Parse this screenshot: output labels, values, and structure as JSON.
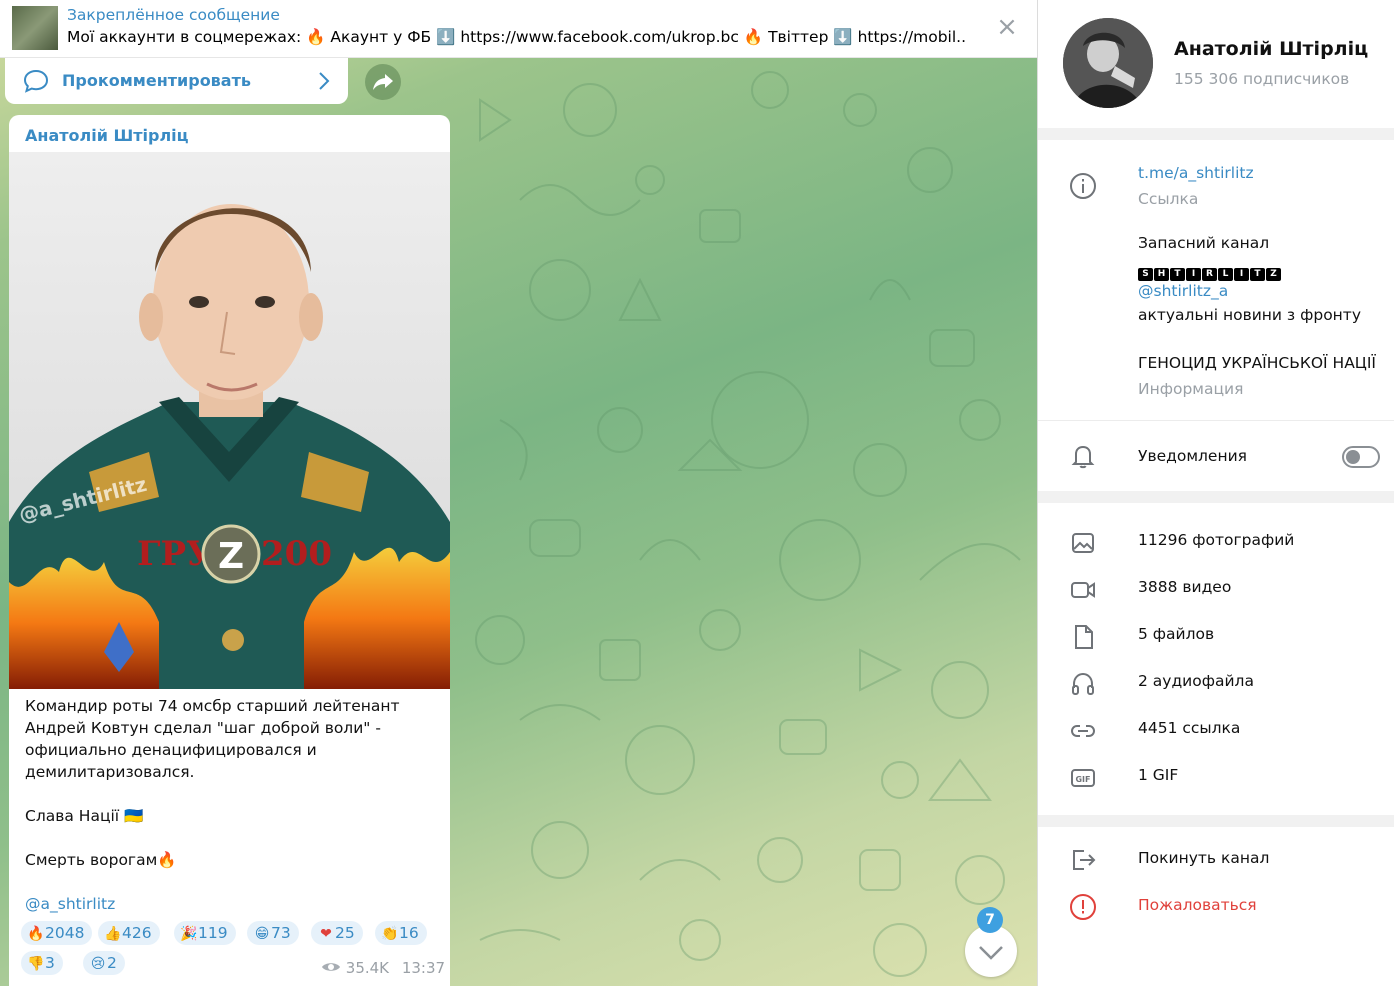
{
  "pinned": {
    "title": "Закреплённое сообщение",
    "text": "Мої аккаунти в соцмережах: 🔥 Акаунт у ФБ ⬇️ https://www.facebook.com/ukrop.bc  🔥 Твіттер ⬇️ https://mobil..."
  },
  "comments": {
    "label": "Прокомментировать"
  },
  "message": {
    "author": "Анатолій Штірліц",
    "photo": {
      "watermark": "@a_shtirlitz",
      "badge_left": "ГРУ",
      "badge_letter": "Z",
      "badge_right": "200"
    },
    "lines": [
      "Командир роты 74 омсбр старший лейтенант",
      "Андрей Ковтун сделал \"шаг доброй воли\" -",
      "официально денацифицировался и",
      "демилитаризовался."
    ],
    "slava": "Слава Нації 🇺🇦",
    "smert": "Смерть ворогам🔥",
    "signature": "@a_shtirlitz",
    "reactions": [
      {
        "emoji": "🔥",
        "count": "2048"
      },
      {
        "emoji": "👍",
        "count": "426"
      },
      {
        "emoji": "🎉",
        "count": "119"
      },
      {
        "emoji": "😁",
        "count": "73"
      },
      {
        "emoji": "❤",
        "count": "25"
      },
      {
        "emoji": "👏",
        "count": "16"
      },
      {
        "emoji": "👎",
        "count": "3"
      },
      {
        "emoji": "😢",
        "count": "2"
      }
    ],
    "views": "35.4K",
    "time": "13:37"
  },
  "scroll": {
    "unread": "7"
  },
  "channel": {
    "name": "Анатолій Штірліц",
    "subscribers": "155 306 подписчиков",
    "link": "t.me/a_shtirlitz",
    "link_caption": "Ссылка",
    "desc_line1": "Запасний канал",
    "desc_badge_letters": [
      "S",
      "H",
      "T",
      "I",
      "R",
      "L",
      "I",
      "T",
      "Z"
    ],
    "desc_handle": "@shtirlitz_a",
    "desc_line3": "актуальні новини з фронту",
    "desc_line4": "ГЕНОЦИД УКРАЇНСЬКОЇ НАЦІЇ",
    "info_caption": "Информация",
    "notifications": "Уведомления",
    "notifications_on": false
  },
  "media": [
    {
      "icon": "photo-icon",
      "label": "11296 фотографий"
    },
    {
      "icon": "video-icon",
      "label": "3888 видео"
    },
    {
      "icon": "file-icon",
      "label": "5 файлов"
    },
    {
      "icon": "audio-icon",
      "label": "2 аудиофайла"
    },
    {
      "icon": "link-icon",
      "label": "4451 ссылка"
    },
    {
      "icon": "gif-icon",
      "label": "1 GIF"
    }
  ],
  "actions": {
    "leave": "Покинуть канал",
    "report": "Пожаловаться"
  },
  "colors": {
    "accent": "#3a8bc4",
    "danger": "#e0413b",
    "reaction_bg": "#e6f1fa"
  }
}
